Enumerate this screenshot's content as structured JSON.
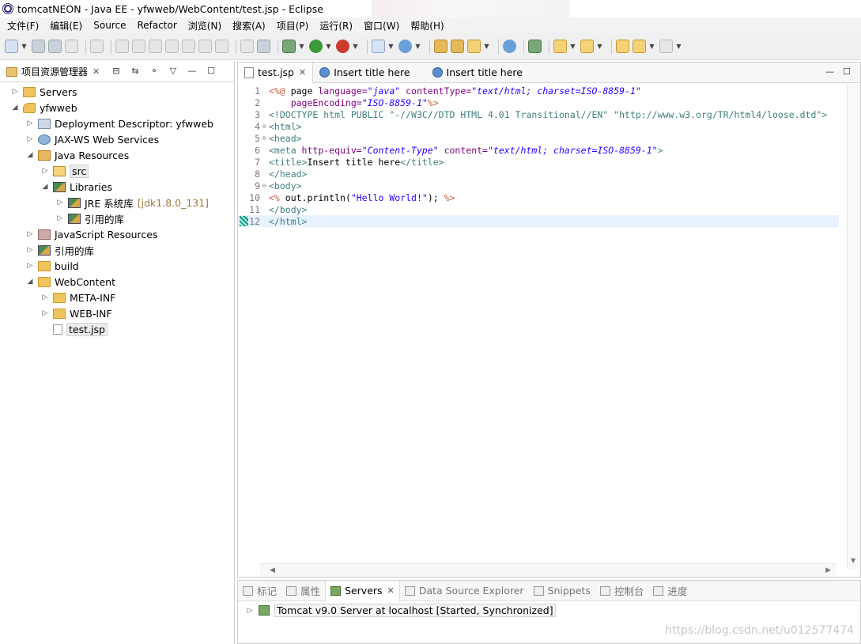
{
  "window": {
    "title": "tomcatNEON  -  Java EE  -  yfwweb/WebContent/test.jsp  -  Eclipse"
  },
  "menubar": {
    "items": [
      "文件(F)",
      "编辑(E)",
      "Source",
      "Refactor",
      "浏览(N)",
      "搜索(A)",
      "项目(P)",
      "运行(R)",
      "窗口(W)",
      "帮助(H)"
    ]
  },
  "project_explorer": {
    "title": "项目资源管理器",
    "tree": [
      {
        "label": "Servers"
      },
      {
        "label": "yfwweb"
      },
      {
        "label": "Deployment Descriptor: yfwweb"
      },
      {
        "label": "JAX-WS Web Services"
      },
      {
        "label": "Java Resources"
      },
      {
        "label": "src"
      },
      {
        "label": "Libraries"
      },
      {
        "label": "JRE 系统库",
        "sub": "[jdk1.8.0_131]"
      },
      {
        "label": "引用的库"
      },
      {
        "label": "JavaScript Resources"
      },
      {
        "label": "引用的库"
      },
      {
        "label": "build"
      },
      {
        "label": "WebContent"
      },
      {
        "label": "META-INF"
      },
      {
        "label": "WEB-INF"
      },
      {
        "label": "test.jsp"
      }
    ]
  },
  "editor": {
    "tabs": [
      {
        "label": "test.jsp"
      },
      {
        "label": "Insert title here"
      },
      {
        "label": "Insert title here"
      }
    ],
    "line_numbers": [
      "1",
      "2",
      "3",
      "4",
      "5",
      "6",
      "7",
      "8",
      "9",
      "10",
      "11",
      "12"
    ],
    "code": {
      "l1_a": "<%@",
      "l1_b": " page ",
      "l1_c": "language=",
      "l1_d": "\"java\"",
      "l1_e": " contentType=",
      "l1_f": "\"text/html; charset=ISO-8859-1\"",
      "l2_a": "    pageEncoding=",
      "l2_b": "\"ISO-8859-1\"",
      "l2_c": "%>",
      "l3_a": "<!DOCTYPE html PUBLIC ",
      "l3_b": "\"-//W3C//DTD HTML 4.01 Transitional//EN\" \"http://www.w3.org/TR/html4/loose.dtd\"",
      "l3_c": ">",
      "l4": "<html>",
      "l5": "<head>",
      "l6_a": "<meta ",
      "l6_b": "http-equiv=",
      "l6_c": "\"Content-Type\"",
      "l6_d": " content=",
      "l6_e": "\"text/html; charset=ISO-8859-1\"",
      "l6_f": ">",
      "l7_a": "<title>",
      "l7_b": "Insert title here",
      "l7_c": "</title>",
      "l8": "</head>",
      "l9": "<body>",
      "l10_a": "<%",
      "l10_b": " out.println(",
      "l10_c": "\"Hello World!\"",
      "l10_d": "); ",
      "l10_e": "%>",
      "l11": "</body>",
      "l12": "</html>"
    }
  },
  "bottom_panel": {
    "tabs": [
      {
        "label": "标记"
      },
      {
        "label": "属性"
      },
      {
        "label": "Servers"
      },
      {
        "label": "Data Source Explorer"
      },
      {
        "label": "Snippets"
      },
      {
        "label": "控制台"
      },
      {
        "label": "进度"
      }
    ],
    "server_entry": "Tomcat v9.0 Server at localhost  [Started, Synchronized]"
  },
  "watermark": "https://blog.csdn.net/u012577474"
}
